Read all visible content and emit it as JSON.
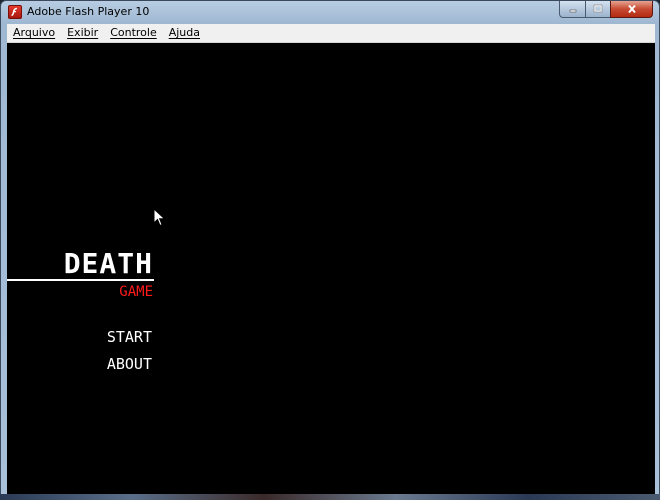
{
  "window": {
    "title": "Adobe Flash Player 10",
    "icon": "flash-player-icon",
    "controls": {
      "minimize": "minimize-icon",
      "maximize": "maximize-icon",
      "close": "close-icon"
    }
  },
  "menubar": {
    "items": [
      {
        "label": "Arquivo"
      },
      {
        "label": "Exibir"
      },
      {
        "label": "Controle"
      },
      {
        "label": "Ajuda"
      }
    ]
  },
  "game": {
    "title": "DEATH",
    "subtitle": "GAME",
    "menu": [
      {
        "label": "START"
      },
      {
        "label": "ABOUT"
      }
    ]
  },
  "colors": {
    "stage_bg": "#000000",
    "title_text": "#ffffff",
    "subtitle_text": "#ff1a1a"
  }
}
